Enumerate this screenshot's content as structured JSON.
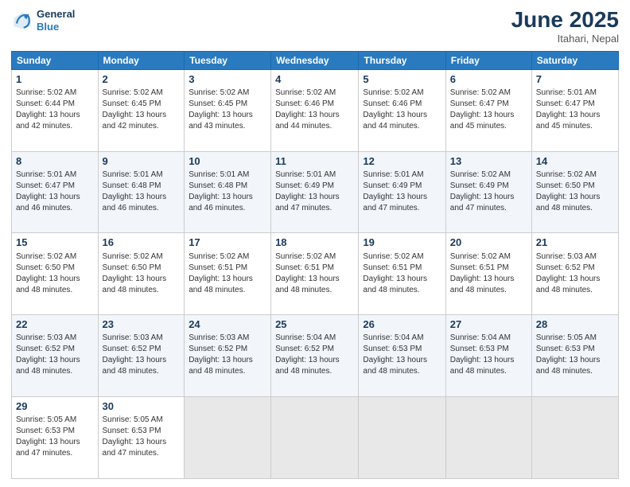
{
  "logo": {
    "line1": "General",
    "line2": "Blue"
  },
  "title": "June 2025",
  "subtitle": "Itahari, Nepal",
  "weekdays": [
    "Sunday",
    "Monday",
    "Tuesday",
    "Wednesday",
    "Thursday",
    "Friday",
    "Saturday"
  ],
  "weeks": [
    [
      {
        "day": "1",
        "sunrise": "Sunrise: 5:02 AM",
        "sunset": "Sunset: 6:44 PM",
        "daylight": "Daylight: 13 hours and 42 minutes."
      },
      {
        "day": "2",
        "sunrise": "Sunrise: 5:02 AM",
        "sunset": "Sunset: 6:45 PM",
        "daylight": "Daylight: 13 hours and 42 minutes."
      },
      {
        "day": "3",
        "sunrise": "Sunrise: 5:02 AM",
        "sunset": "Sunset: 6:45 PM",
        "daylight": "Daylight: 13 hours and 43 minutes."
      },
      {
        "day": "4",
        "sunrise": "Sunrise: 5:02 AM",
        "sunset": "Sunset: 6:46 PM",
        "daylight": "Daylight: 13 hours and 44 minutes."
      },
      {
        "day": "5",
        "sunrise": "Sunrise: 5:02 AM",
        "sunset": "Sunset: 6:46 PM",
        "daylight": "Daylight: 13 hours and 44 minutes."
      },
      {
        "day": "6",
        "sunrise": "Sunrise: 5:02 AM",
        "sunset": "Sunset: 6:47 PM",
        "daylight": "Daylight: 13 hours and 45 minutes."
      },
      {
        "day": "7",
        "sunrise": "Sunrise: 5:01 AM",
        "sunset": "Sunset: 6:47 PM",
        "daylight": "Daylight: 13 hours and 45 minutes."
      }
    ],
    [
      {
        "day": "8",
        "sunrise": "Sunrise: 5:01 AM",
        "sunset": "Sunset: 6:47 PM",
        "daylight": "Daylight: 13 hours and 46 minutes."
      },
      {
        "day": "9",
        "sunrise": "Sunrise: 5:01 AM",
        "sunset": "Sunset: 6:48 PM",
        "daylight": "Daylight: 13 hours and 46 minutes."
      },
      {
        "day": "10",
        "sunrise": "Sunrise: 5:01 AM",
        "sunset": "Sunset: 6:48 PM",
        "daylight": "Daylight: 13 hours and 46 minutes."
      },
      {
        "day": "11",
        "sunrise": "Sunrise: 5:01 AM",
        "sunset": "Sunset: 6:49 PM",
        "daylight": "Daylight: 13 hours and 47 minutes."
      },
      {
        "day": "12",
        "sunrise": "Sunrise: 5:01 AM",
        "sunset": "Sunset: 6:49 PM",
        "daylight": "Daylight: 13 hours and 47 minutes."
      },
      {
        "day": "13",
        "sunrise": "Sunrise: 5:02 AM",
        "sunset": "Sunset: 6:49 PM",
        "daylight": "Daylight: 13 hours and 47 minutes."
      },
      {
        "day": "14",
        "sunrise": "Sunrise: 5:02 AM",
        "sunset": "Sunset: 6:50 PM",
        "daylight": "Daylight: 13 hours and 48 minutes."
      }
    ],
    [
      {
        "day": "15",
        "sunrise": "Sunrise: 5:02 AM",
        "sunset": "Sunset: 6:50 PM",
        "daylight": "Daylight: 13 hours and 48 minutes."
      },
      {
        "day": "16",
        "sunrise": "Sunrise: 5:02 AM",
        "sunset": "Sunset: 6:50 PM",
        "daylight": "Daylight: 13 hours and 48 minutes."
      },
      {
        "day": "17",
        "sunrise": "Sunrise: 5:02 AM",
        "sunset": "Sunset: 6:51 PM",
        "daylight": "Daylight: 13 hours and 48 minutes."
      },
      {
        "day": "18",
        "sunrise": "Sunrise: 5:02 AM",
        "sunset": "Sunset: 6:51 PM",
        "daylight": "Daylight: 13 hours and 48 minutes."
      },
      {
        "day": "19",
        "sunrise": "Sunrise: 5:02 AM",
        "sunset": "Sunset: 6:51 PM",
        "daylight": "Daylight: 13 hours and 48 minutes."
      },
      {
        "day": "20",
        "sunrise": "Sunrise: 5:02 AM",
        "sunset": "Sunset: 6:51 PM",
        "daylight": "Daylight: 13 hours and 48 minutes."
      },
      {
        "day": "21",
        "sunrise": "Sunrise: 5:03 AM",
        "sunset": "Sunset: 6:52 PM",
        "daylight": "Daylight: 13 hours and 48 minutes."
      }
    ],
    [
      {
        "day": "22",
        "sunrise": "Sunrise: 5:03 AM",
        "sunset": "Sunset: 6:52 PM",
        "daylight": "Daylight: 13 hours and 48 minutes."
      },
      {
        "day": "23",
        "sunrise": "Sunrise: 5:03 AM",
        "sunset": "Sunset: 6:52 PM",
        "daylight": "Daylight: 13 hours and 48 minutes."
      },
      {
        "day": "24",
        "sunrise": "Sunrise: 5:03 AM",
        "sunset": "Sunset: 6:52 PM",
        "daylight": "Daylight: 13 hours and 48 minutes."
      },
      {
        "day": "25",
        "sunrise": "Sunrise: 5:04 AM",
        "sunset": "Sunset: 6:52 PM",
        "daylight": "Daylight: 13 hours and 48 minutes."
      },
      {
        "day": "26",
        "sunrise": "Sunrise: 5:04 AM",
        "sunset": "Sunset: 6:53 PM",
        "daylight": "Daylight: 13 hours and 48 minutes."
      },
      {
        "day": "27",
        "sunrise": "Sunrise: 5:04 AM",
        "sunset": "Sunset: 6:53 PM",
        "daylight": "Daylight: 13 hours and 48 minutes."
      },
      {
        "day": "28",
        "sunrise": "Sunrise: 5:05 AM",
        "sunset": "Sunset: 6:53 PM",
        "daylight": "Daylight: 13 hours and 48 minutes."
      }
    ],
    [
      {
        "day": "29",
        "sunrise": "Sunrise: 5:05 AM",
        "sunset": "Sunset: 6:53 PM",
        "daylight": "Daylight: 13 hours and 47 minutes."
      },
      {
        "day": "30",
        "sunrise": "Sunrise: 5:05 AM",
        "sunset": "Sunset: 6:53 PM",
        "daylight": "Daylight: 13 hours and 47 minutes."
      },
      {
        "day": "",
        "sunrise": "",
        "sunset": "",
        "daylight": ""
      },
      {
        "day": "",
        "sunrise": "",
        "sunset": "",
        "daylight": ""
      },
      {
        "day": "",
        "sunrise": "",
        "sunset": "",
        "daylight": ""
      },
      {
        "day": "",
        "sunrise": "",
        "sunset": "",
        "daylight": ""
      },
      {
        "day": "",
        "sunrise": "",
        "sunset": "",
        "daylight": ""
      }
    ]
  ]
}
